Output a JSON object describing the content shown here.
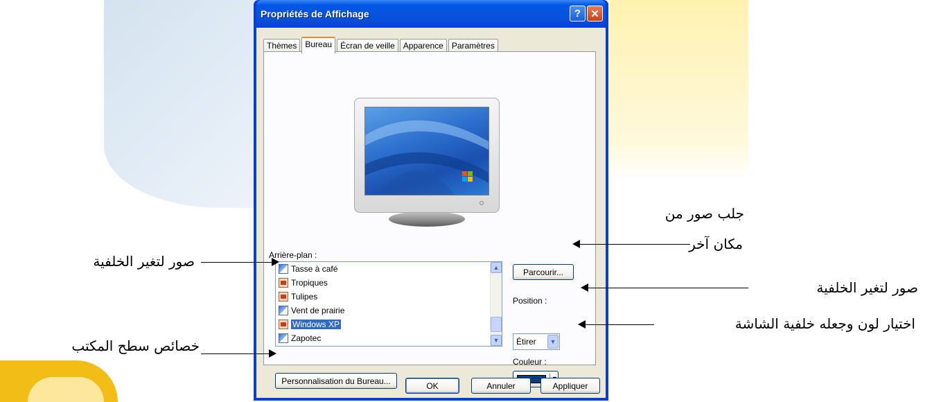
{
  "window": {
    "title": "Propriétés de Affichage",
    "help_label": "?",
    "close_label": "✕"
  },
  "tabs": [
    {
      "label": "Thèmes",
      "active": false
    },
    {
      "label": "Bureau",
      "active": true
    },
    {
      "label": "Écran de veille",
      "active": false
    },
    {
      "label": "Apparence",
      "active": false
    },
    {
      "label": "Paramètres",
      "active": false
    }
  ],
  "background": {
    "label": "Arrière-plan :",
    "items": [
      {
        "label": "Tasse à café",
        "icon": "bitmap-icon",
        "selected": false
      },
      {
        "label": "Tropiques",
        "icon": "jpeg-icon",
        "selected": false
      },
      {
        "label": "Tulipes",
        "icon": "jpeg-icon",
        "selected": false
      },
      {
        "label": "Vent de prairie",
        "icon": "bitmap-icon",
        "selected": false
      },
      {
        "label": "Windows XP",
        "icon": "jpeg-icon",
        "selected": true
      },
      {
        "label": "Zapotec",
        "icon": "bitmap-icon",
        "selected": false
      }
    ],
    "scroll_up": "▲",
    "scroll_down": "▼"
  },
  "browse_label": "Parcourir...",
  "position": {
    "label": "Position :",
    "value": "Étirer",
    "arrow": "▼"
  },
  "color": {
    "label": "Couleur :",
    "value": "#0a3d7a",
    "arrow": "▼"
  },
  "customize_label": "Personnalisation du Bureau...",
  "footer": {
    "ok": "OK",
    "cancel": "Annuler",
    "apply": "Appliquer"
  },
  "annotations": {
    "browse_line1": "جلب صور من",
    "browse_line2": "مكان آخر",
    "list": "صور لتغير الخلفية",
    "position": "صور لتغير الخلفية",
    "color": "اختيار لون وجعله خلفية الشاشة",
    "customize": "خصائص سطح المكتب"
  }
}
